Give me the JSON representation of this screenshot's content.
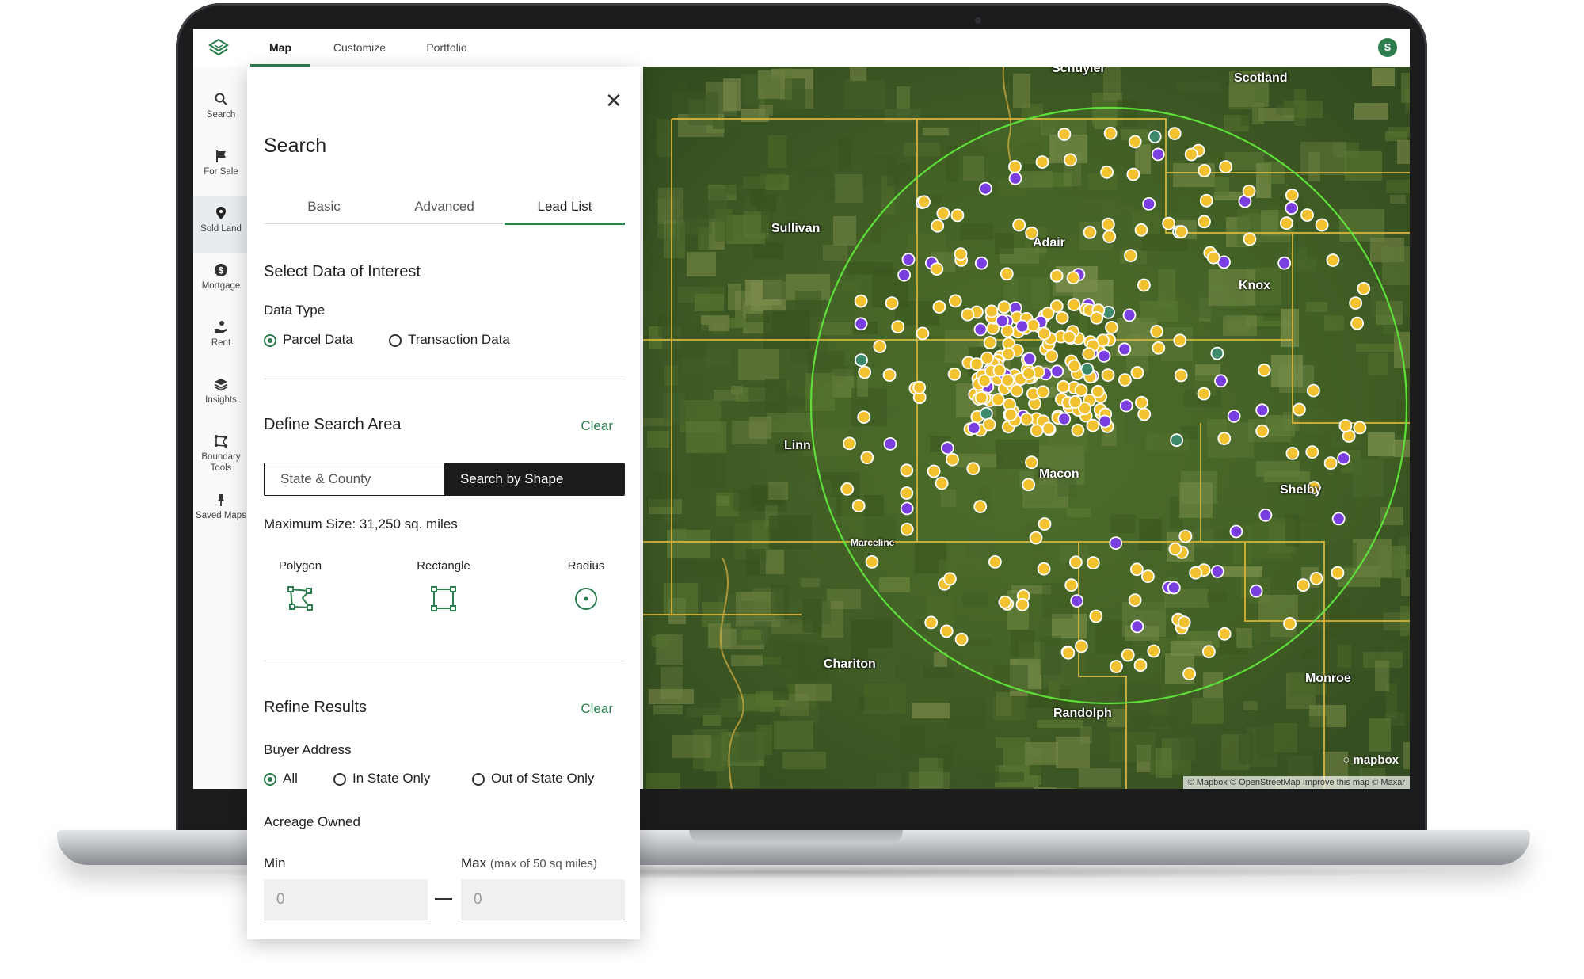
{
  "topbar": {
    "tabs": [
      {
        "label": "Map",
        "active": true
      },
      {
        "label": "Customize",
        "active": false
      },
      {
        "label": "Portfolio",
        "active": false
      }
    ],
    "avatar_initial": "S",
    "accent_color": "#2e7d4f"
  },
  "sidebar": {
    "items": [
      {
        "label": "Search",
        "icon": "search-icon",
        "active": false
      },
      {
        "label": "For Sale",
        "icon": "flag-icon",
        "active": false
      },
      {
        "label": "Sold Land",
        "icon": "map-pin-icon",
        "active": true
      },
      {
        "label": "Mortgage",
        "icon": "dollar-icon",
        "active": false
      },
      {
        "label": "Rent",
        "icon": "hand-coin-icon",
        "active": false
      },
      {
        "label": "Insights",
        "icon": "layers-icon",
        "active": false
      },
      {
        "label": "Boundary Tools",
        "icon": "boundary-icon",
        "active": false
      },
      {
        "label": "Saved Maps",
        "icon": "pin-icon",
        "active": false
      }
    ]
  },
  "panel": {
    "title": "Search",
    "tabs": [
      {
        "label": "Basic",
        "active": false
      },
      {
        "label": "Advanced",
        "active": false
      },
      {
        "label": "Lead List",
        "active": true
      }
    ],
    "data_of_interest": {
      "title": "Select Data of Interest",
      "data_type_label": "Data Type",
      "options": [
        {
          "label": "Parcel Data",
          "selected": true
        },
        {
          "label": "Transaction Data",
          "selected": false
        }
      ]
    },
    "search_area": {
      "title": "Define Search Area",
      "clear_label": "Clear",
      "modes": [
        {
          "label": "State & County",
          "selected": false
        },
        {
          "label": "Search by Shape",
          "selected": true
        }
      ],
      "max_size": "Maximum Size: 31,250 sq. miles",
      "shapes": [
        {
          "label": "Polygon",
          "icon": "polygon-icon"
        },
        {
          "label": "Rectangle",
          "icon": "rectangle-icon"
        },
        {
          "label": "Radius",
          "icon": "radius-icon"
        }
      ]
    },
    "refine": {
      "title": "Refine Results",
      "clear_label": "Clear",
      "buyer_address_label": "Buyer Address",
      "buyer_options": [
        {
          "label": "All",
          "selected": true
        },
        {
          "label": "In State Only",
          "selected": false
        },
        {
          "label": "Out of State Only",
          "selected": false
        }
      ],
      "acreage_label": "Acreage Owned",
      "min_label": "Min",
      "max_label": "Max",
      "max_hint": "(max of 50 sq miles)",
      "min_value": "0",
      "max_value": "0"
    },
    "close_icon": "close-icon"
  },
  "map": {
    "labels": [
      {
        "text": "Schuyler",
        "key": "schuyler"
      },
      {
        "text": "Scotland",
        "key": "scotland"
      },
      {
        "text": "Sullivan",
        "key": "sullivan"
      },
      {
        "text": "Adair",
        "key": "adair"
      },
      {
        "text": "Knox",
        "key": "knox"
      },
      {
        "text": "Linn",
        "key": "linn"
      },
      {
        "text": "Macon",
        "key": "macon"
      },
      {
        "text": "Shelby",
        "key": "shelby"
      },
      {
        "text": "Marceline",
        "key": "marceline"
      },
      {
        "text": "Chariton",
        "key": "chariton"
      },
      {
        "text": "Monroe",
        "key": "monroe"
      },
      {
        "text": "Randolph",
        "key": "randolph"
      }
    ],
    "mapbox_logo": "mapbox",
    "attribution": "© Mapbox © OpenStreetMap Improve this map © Maxar",
    "colors": {
      "sold": "#f2c230",
      "for_sale": "#7a3fe0",
      "other": "#3c8a6a",
      "radius": "#5ee03a",
      "county_line": "#d8b23a"
    }
  }
}
